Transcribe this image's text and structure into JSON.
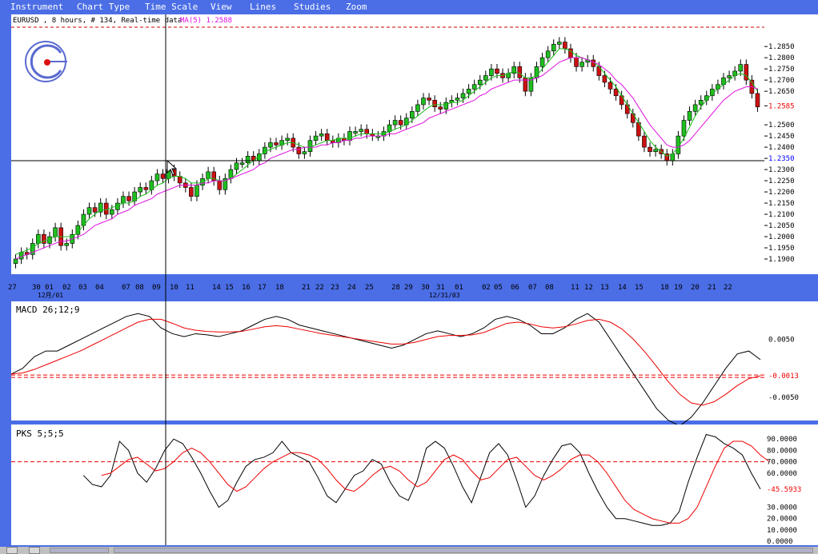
{
  "menu": [
    "Instrument",
    "Chart Type",
    "Time Scale",
    "View",
    "Lines",
    "Studies",
    "Zoom"
  ],
  "colors": {
    "bg": "#4b6ee6",
    "up": "#1fbf1f",
    "down": "#cc1111",
    "ma_fast": "#18c018",
    "ma_slow": "#e010e0",
    "signal": "#ee0000",
    "price_marker": "#ee0000",
    "crosshair_value": "#0000ff"
  },
  "icons": {
    "logo": "circle-c-logo-icon",
    "cursor": "mouse-pointer-icon"
  },
  "chart_data": [
    {
      "type": "candlestick",
      "title": "EURUSD , 8 hours, # 134, Real-time data",
      "overlay_label": "MA(5) 1.2588",
      "ylim": [
        1.185,
        1.2915
      ],
      "y_ticks": [
        "1.2850",
        "1.2800",
        "1.2750",
        "1.2700",
        "1.2650",
        "1.2585",
        "1.2500",
        "1.2450",
        "1.2400",
        "1.2350",
        "1.2300",
        "1.2250",
        "1.2200",
        "1.2150",
        "1.2100",
        "1.2050",
        "1.2000",
        "1.1950",
        "1.1900"
      ],
      "last_price": "1.2585",
      "crosshair_price": "1.2350",
      "x_ticks": [
        "27",
        "30",
        "01",
        "02",
        "03",
        "04",
        "07",
        "08",
        "09",
        "10",
        "11",
        "14",
        "15",
        "16",
        "17",
        "18",
        "21",
        "22",
        "23",
        "24",
        "25",
        "28",
        "29",
        "30",
        "31",
        "01",
        "02",
        "05",
        "06",
        "07",
        "08",
        "11",
        "12",
        "13",
        "14",
        "15",
        "18",
        "19",
        "20",
        "21",
        "22"
      ],
      "x_sub_labels": [
        "12月/01",
        "12/31/03"
      ],
      "closes": [
        1.19,
        1.193,
        1.192,
        1.197,
        1.201,
        1.197,
        1.2,
        1.204,
        1.196,
        1.197,
        1.201,
        1.205,
        1.21,
        1.213,
        1.211,
        1.215,
        1.21,
        1.212,
        1.215,
        1.218,
        1.216,
        1.22,
        1.222,
        1.221,
        1.225,
        1.228,
        1.226,
        1.23,
        1.227,
        1.224,
        1.222,
        1.218,
        1.223,
        1.226,
        1.229,
        1.225,
        1.221,
        1.226,
        1.23,
        1.233,
        1.233,
        1.236,
        1.234,
        1.237,
        1.24,
        1.242,
        1.241,
        1.243,
        1.244,
        1.24,
        1.237,
        1.238,
        1.243,
        1.245,
        1.246,
        1.243,
        1.242,
        1.244,
        1.243,
        1.247,
        1.247,
        1.248,
        1.246,
        1.245,
        1.245,
        1.247,
        1.25,
        1.252,
        1.25,
        1.253,
        1.256,
        1.259,
        1.262,
        1.261,
        1.258,
        1.257,
        1.26,
        1.261,
        1.262,
        1.264,
        1.266,
        1.268,
        1.27,
        1.272,
        1.275,
        1.273,
        1.271,
        1.273,
        1.276,
        1.271,
        1.265,
        1.271,
        1.276,
        1.28,
        1.283,
        1.286,
        1.287,
        1.284,
        1.28,
        1.276,
        1.278,
        1.279,
        1.276,
        1.272,
        1.269,
        1.266,
        1.263,
        1.259,
        1.255,
        1.251,
        1.245,
        1.24,
        1.238,
        1.239,
        1.237,
        1.234,
        1.237,
        1.245,
        1.252,
        1.256,
        1.259,
        1.261,
        1.263,
        1.266,
        1.268,
        1.271,
        1.272,
        1.274,
        1.277,
        1.27,
        1.264,
        1.258
      ],
      "ma_fast": [
        1.192,
        1.193,
        1.194,
        1.195,
        1.197,
        1.198,
        1.199,
        1.2,
        1.2,
        1.2,
        1.2,
        1.202,
        1.205,
        1.208,
        1.21,
        1.212,
        1.212,
        1.213,
        1.214,
        1.215,
        1.215,
        1.216,
        1.218,
        1.219,
        1.221,
        1.223,
        1.224,
        1.226,
        1.227,
        1.227,
        1.226,
        1.224,
        1.224,
        1.224,
        1.226,
        1.226,
        1.225,
        1.225,
        1.226,
        1.228,
        1.23,
        1.232,
        1.234,
        1.236,
        1.238,
        1.239,
        1.24,
        1.241,
        1.242,
        1.242,
        1.241,
        1.24,
        1.24,
        1.241,
        1.242,
        1.243,
        1.243,
        1.244,
        1.244,
        1.244,
        1.245,
        1.246,
        1.246,
        1.246,
        1.246,
        1.246,
        1.247,
        1.248,
        1.249,
        1.25,
        1.252,
        1.254,
        1.256,
        1.258,
        1.259,
        1.259,
        1.259,
        1.26,
        1.26,
        1.261,
        1.263,
        1.265,
        1.267,
        1.269,
        1.271,
        1.272,
        1.272,
        1.273,
        1.274,
        1.273,
        1.271,
        1.271,
        1.272,
        1.275,
        1.278,
        1.281,
        1.284,
        1.284,
        1.283,
        1.281,
        1.28,
        1.279,
        1.278,
        1.276,
        1.273,
        1.27,
        1.267,
        1.263,
        1.259,
        1.255,
        1.251,
        1.247,
        1.243,
        1.24,
        1.238,
        1.236,
        1.237,
        1.24,
        1.244,
        1.249,
        1.254,
        1.258,
        1.261,
        1.264,
        1.266,
        1.268,
        1.27,
        1.272,
        1.273,
        1.272,
        1.269,
        1.265
      ],
      "ma_slow": [
        1.19,
        1.191,
        1.192,
        1.193,
        1.194,
        1.195,
        1.196,
        1.197,
        1.198,
        1.198,
        1.199,
        1.2,
        1.201,
        1.203,
        1.205,
        1.206,
        1.207,
        1.208,
        1.21,
        1.211,
        1.212,
        1.214,
        1.215,
        1.216,
        1.217,
        1.219,
        1.22,
        1.221,
        1.222,
        1.223,
        1.223,
        1.223,
        1.223,
        1.224,
        1.224,
        1.225,
        1.225,
        1.225,
        1.226,
        1.227,
        1.228,
        1.229,
        1.23,
        1.232,
        1.233,
        1.235,
        1.236,
        1.237,
        1.238,
        1.239,
        1.239,
        1.24,
        1.24,
        1.24,
        1.241,
        1.241,
        1.242,
        1.242,
        1.243,
        1.243,
        1.244,
        1.244,
        1.245,
        1.245,
        1.245,
        1.245,
        1.246,
        1.246,
        1.247,
        1.248,
        1.249,
        1.25,
        1.251,
        1.253,
        1.254,
        1.255,
        1.256,
        1.257,
        1.258,
        1.259,
        1.26,
        1.261,
        1.263,
        1.264,
        1.266,
        1.267,
        1.268,
        1.269,
        1.27,
        1.27,
        1.27,
        1.27,
        1.271,
        1.272,
        1.274,
        1.276,
        1.278,
        1.279,
        1.28,
        1.28,
        1.28,
        1.279,
        1.278,
        1.277,
        1.275,
        1.273,
        1.27,
        1.268,
        1.265,
        1.262,
        1.258,
        1.254,
        1.25,
        1.247,
        1.244,
        1.241,
        1.24,
        1.24,
        1.241,
        1.243,
        1.246,
        1.249,
        1.252,
        1.255,
        1.258,
        1.261,
        1.263,
        1.265,
        1.266,
        1.267,
        1.267,
        1.266
      ]
    },
    {
      "type": "line",
      "title": "MACD 26;12;9",
      "ylim": [
        -0.0085,
        0.0105
      ],
      "y_ticks": [
        "0.0050",
        "-0.0013",
        "-0.0050"
      ],
      "y_tick_values": [
        0.005,
        -0.0013,
        -0.005
      ],
      "reference_line": -0.0013,
      "macd": [
        -0.001,
        0.0,
        0.002,
        0.003,
        0.003,
        0.004,
        0.005,
        0.006,
        0.007,
        0.008,
        0.009,
        0.0095,
        0.009,
        0.007,
        0.006,
        0.0055,
        0.006,
        0.0058,
        0.0055,
        0.006,
        0.0065,
        0.0075,
        0.0085,
        0.009,
        0.0085,
        0.0075,
        0.007,
        0.0065,
        0.006,
        0.0055,
        0.005,
        0.0045,
        0.004,
        0.0035,
        0.004,
        0.005,
        0.006,
        0.0065,
        0.006,
        0.0055,
        0.006,
        0.007,
        0.0085,
        0.009,
        0.0085,
        0.0075,
        0.006,
        0.006,
        0.007,
        0.0085,
        0.0095,
        0.008,
        0.005,
        0.002,
        -0.001,
        -0.004,
        -0.007,
        -0.009,
        -0.01,
        -0.0085,
        -0.006,
        -0.003,
        0.0,
        0.0025,
        0.003,
        0.0015
      ],
      "signal": [
        -0.001,
        -0.0008,
        -0.0002,
        0.0006,
        0.0014,
        0.0022,
        0.003,
        0.004,
        0.005,
        0.006,
        0.007,
        0.008,
        0.0085,
        0.0085,
        0.0078,
        0.007,
        0.0066,
        0.0064,
        0.0063,
        0.0063,
        0.0064,
        0.0068,
        0.0072,
        0.0074,
        0.0072,
        0.0068,
        0.0064,
        0.006,
        0.0057,
        0.0054,
        0.0051,
        0.0048,
        0.0045,
        0.0042,
        0.0042,
        0.0045,
        0.005,
        0.0055,
        0.0057,
        0.0057,
        0.0058,
        0.0062,
        0.007,
        0.0078,
        0.008,
        0.0077,
        0.0072,
        0.007,
        0.0072,
        0.0077,
        0.0083,
        0.0085,
        0.008,
        0.0068,
        0.005,
        0.0028,
        0.0003,
        -0.0023,
        -0.0045,
        -0.006,
        -0.0064,
        -0.0058,
        -0.0045,
        -0.003,
        -0.0018,
        -0.0013
      ]
    },
    {
      "type": "line",
      "title": "PKS 5;5;5",
      "ylim": [
        -2,
        100
      ],
      "y_ticks": [
        "90.0000",
        "80.0000",
        "70.0000",
        "60.0000",
        "-45.5933",
        "30.0000",
        "20.0000",
        "10.0000",
        "0.0000"
      ],
      "y_tick_values": [
        90,
        80,
        70,
        60,
        46,
        30,
        20,
        10,
        0
      ],
      "reference_line": 70,
      "k": [
        null,
        null,
        null,
        null,
        null,
        null,
        null,
        null,
        58,
        50,
        48,
        58,
        88,
        80,
        60,
        52,
        64,
        80,
        90,
        86,
        74,
        60,
        44,
        30,
        36,
        52,
        66,
        72,
        74,
        78,
        88,
        78,
        74,
        70,
        56,
        40,
        34,
        46,
        58,
        62,
        72,
        68,
        52,
        40,
        36,
        54,
        82,
        88,
        82,
        66,
        48,
        34,
        56,
        78,
        86,
        76,
        54,
        30,
        40,
        58,
        72,
        84,
        86,
        78,
        60,
        44,
        30,
        20,
        20,
        18,
        16,
        14,
        14,
        16,
        26,
        52,
        74,
        94,
        92,
        86,
        82,
        76,
        60,
        46
      ],
      "d": [
        null,
        null,
        null,
        null,
        null,
        null,
        null,
        null,
        null,
        null,
        58,
        60,
        66,
        72,
        74,
        68,
        62,
        64,
        70,
        78,
        82,
        78,
        70,
        60,
        50,
        44,
        48,
        56,
        64,
        70,
        74,
        78,
        78,
        76,
        72,
        64,
        54,
        46,
        44,
        50,
        58,
        64,
        66,
        62,
        54,
        48,
        52,
        62,
        72,
        76,
        72,
        62,
        54,
        56,
        64,
        72,
        74,
        66,
        58,
        54,
        58,
        64,
        72,
        76,
        76,
        70,
        60,
        48,
        36,
        28,
        24,
        20,
        18,
        16,
        16,
        20,
        30,
        48,
        66,
        82,
        88,
        88,
        84,
        76,
        70
      ]
    }
  ]
}
